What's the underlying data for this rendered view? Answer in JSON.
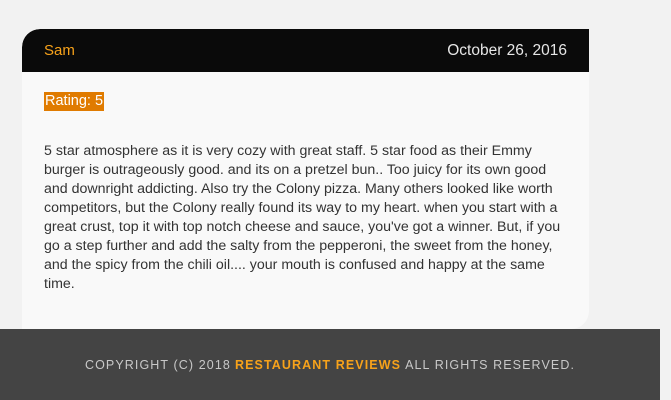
{
  "review": {
    "reviewer": "Sam",
    "date": "October 26, 2016",
    "rating_label": "Rating: 5",
    "text": "5 star atmosphere as it is very cozy with great staff. 5 star food as their Emmy burger is outrageously good. and its on a pretzel bun.. Too juicy for its own good and downright addicting. Also try the Colony pizza. Many others looked like worth competitors, but the Colony really found its way to my heart. when you start with a great crust, top it with top notch cheese and sauce, you've got a winner. But, if you go a step further and add the salty from the pepperoni, the sweet from the honey, and the spicy from the chili oil.... your mouth is confused and happy at the same time."
  },
  "footer": {
    "prefix": "Copyright (c) 2018",
    "brand": "Restaurant Reviews",
    "suffix": "All Rights Reserved."
  },
  "colors": {
    "accent": "#f7a21a",
    "rating_badge": "#e07b00",
    "header_bg": "#0a0a0a",
    "footer_bg": "#444444"
  }
}
